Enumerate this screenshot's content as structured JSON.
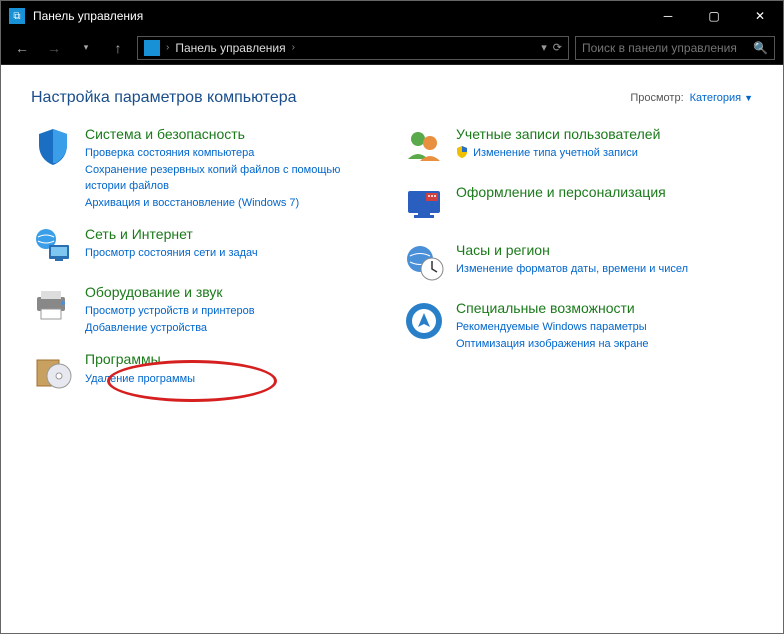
{
  "window": {
    "title": "Панель управления"
  },
  "navbar": {
    "address": "Панель управления",
    "search_placeholder": "Поиск в панели управления"
  },
  "header": {
    "heading": "Настройка параметров компьютера",
    "view_label": "Просмотр:",
    "view_value": "Категория"
  },
  "left": [
    {
      "title": "Система и безопасность",
      "links": [
        "Проверка состояния компьютера",
        "Сохранение резервных копий файлов с помощью истории файлов",
        "Архивация и восстановление (Windows 7)"
      ]
    },
    {
      "title": "Сеть и Интернет",
      "links": [
        "Просмотр состояния сети и задач"
      ]
    },
    {
      "title": "Оборудование и звук",
      "links": [
        "Просмотр устройств и принтеров",
        "Добавление устройства"
      ]
    },
    {
      "title": "Программы",
      "links": [
        "Удаление программы"
      ]
    }
  ],
  "right": [
    {
      "title": "Учетные записи пользователей",
      "links": [
        "Изменение типа учетной записи"
      ],
      "shield": [
        true
      ]
    },
    {
      "title": "Оформление и персонализация",
      "links": []
    },
    {
      "title": "Часы и регион",
      "links": [
        "Изменение форматов даты, времени и чисел"
      ]
    },
    {
      "title": "Специальные возможности",
      "links": [
        "Рекомендуемые Windows параметры",
        "Оптимизация изображения на экране"
      ]
    }
  ]
}
